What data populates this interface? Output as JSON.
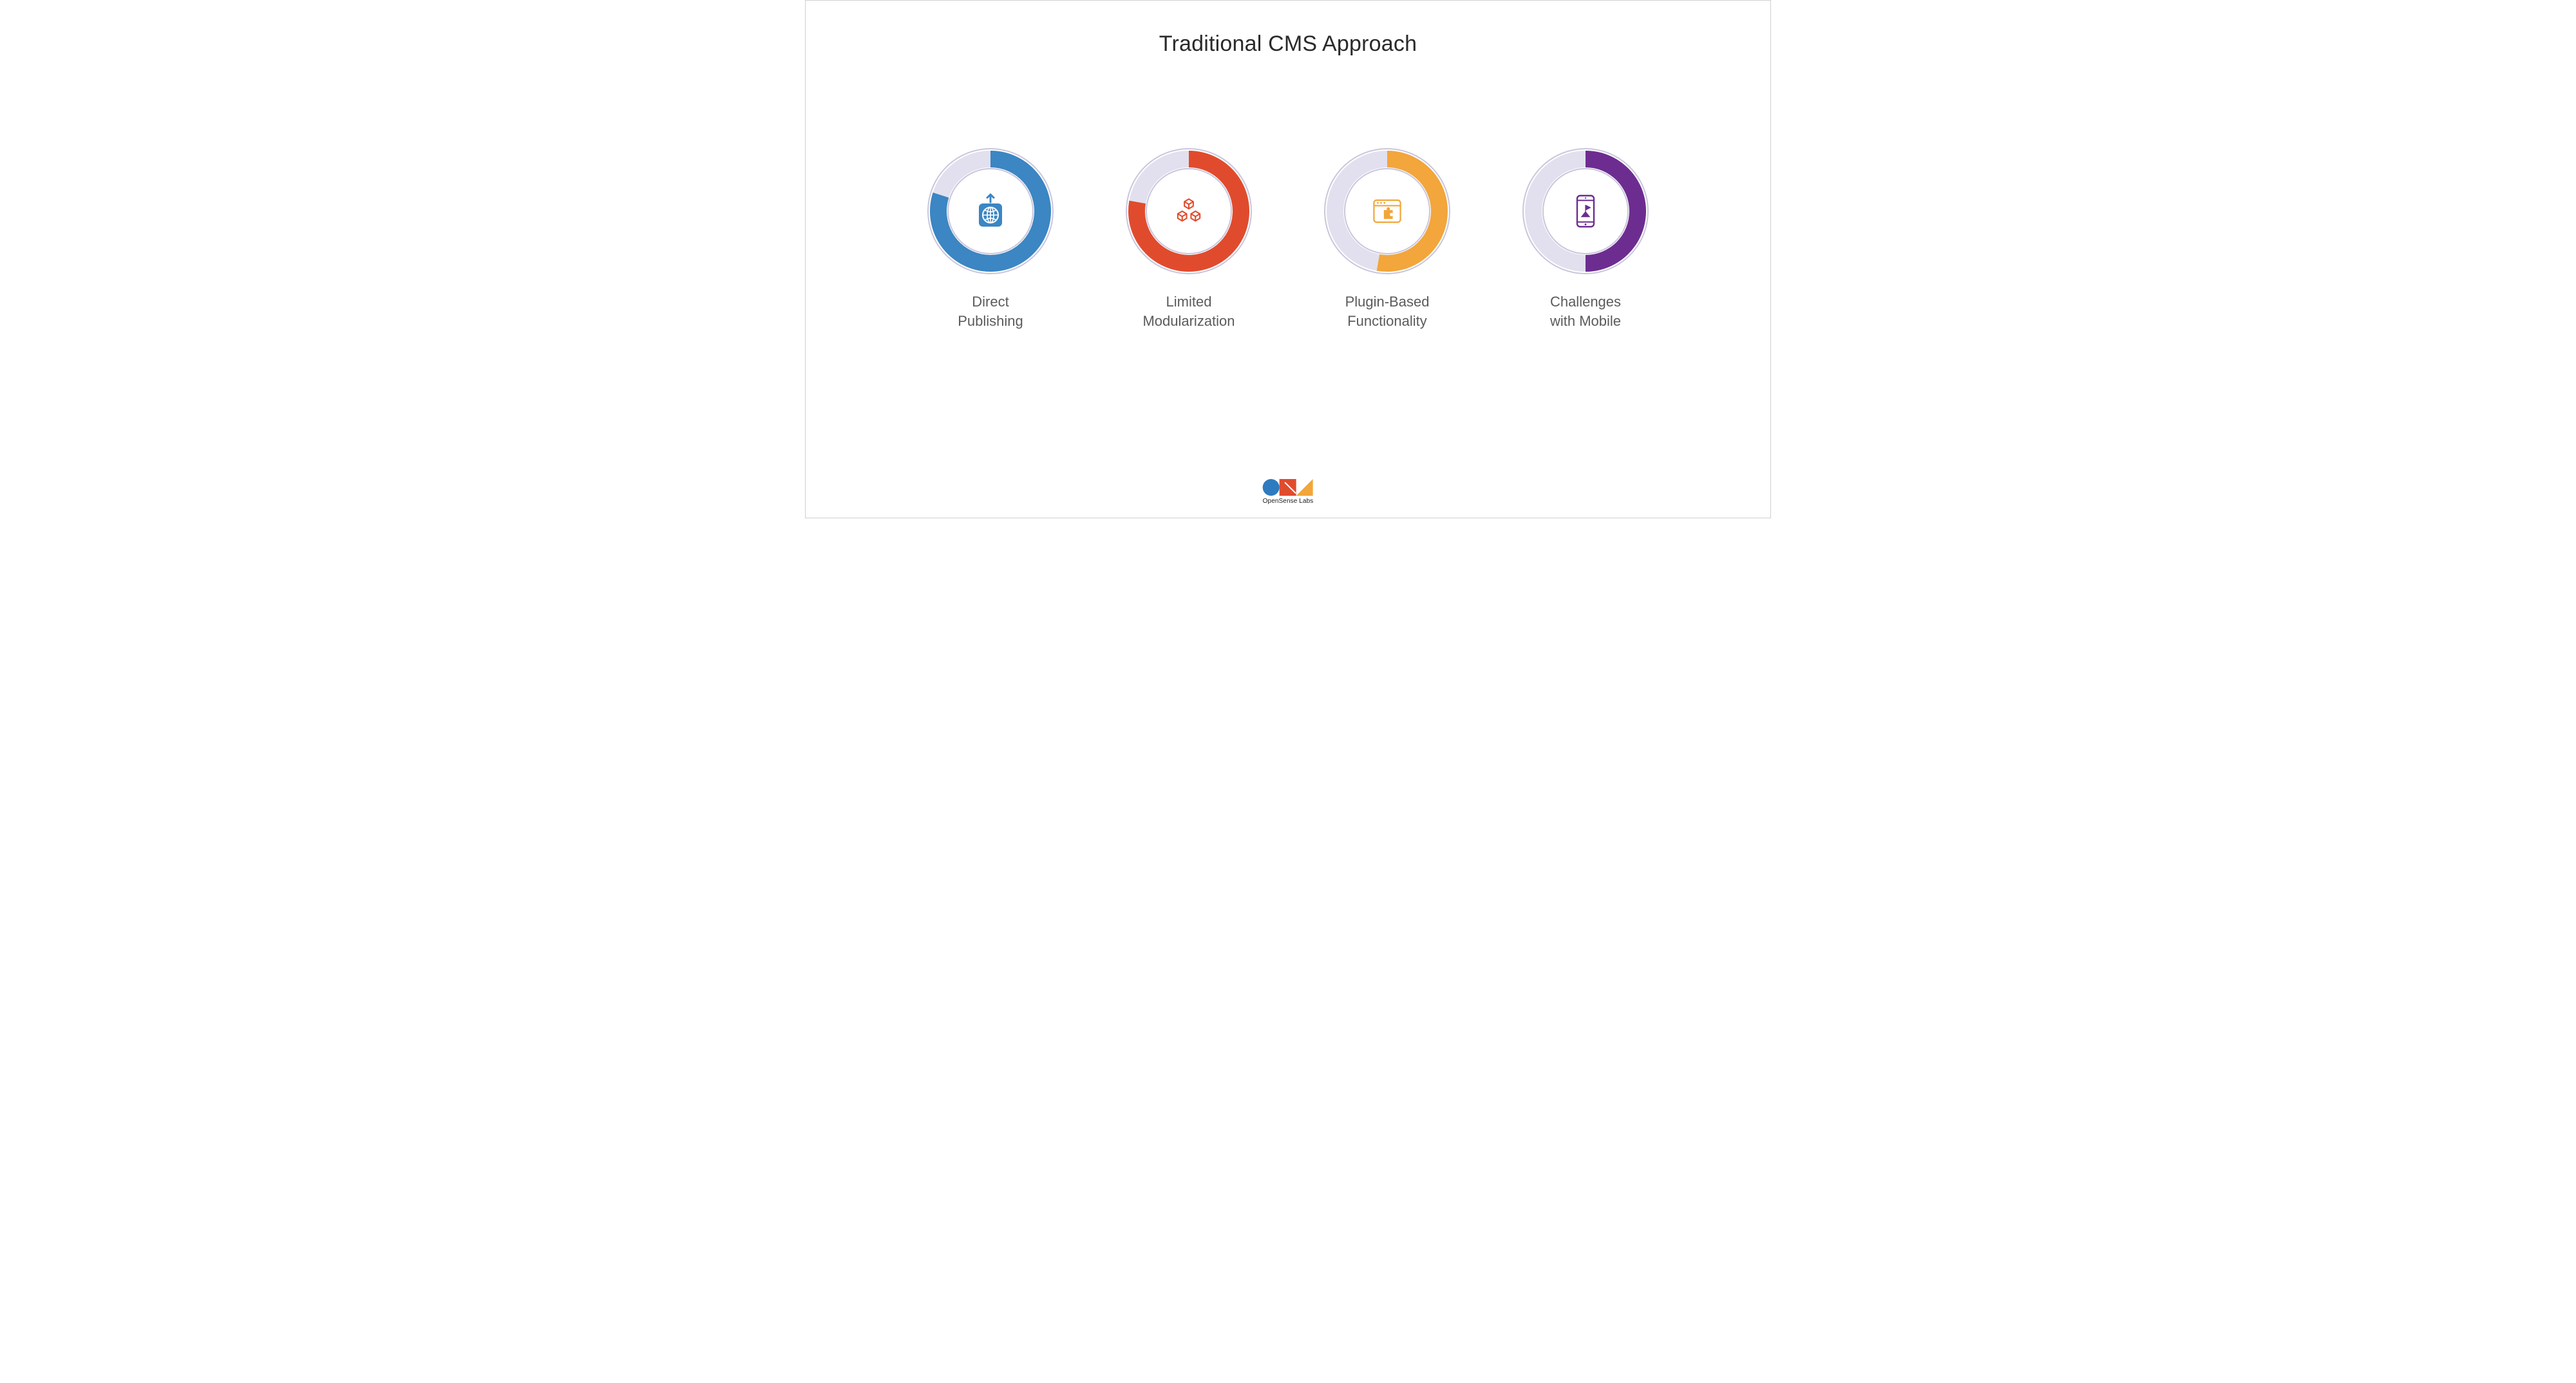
{
  "title": "Traditional CMS Approach",
  "items": [
    {
      "label": "Direct\nPublishing",
      "color": "#3b86c3",
      "arc_start_deg": 0,
      "arc_end_deg": 288,
      "icon": "globe-upload"
    },
    {
      "label": "Limited\nModularization",
      "color": "#e14b2d",
      "arc_start_deg": 0,
      "arc_end_deg": 280,
      "icon": "cubes"
    },
    {
      "label": "Plugin-Based\nFunctionality",
      "color": "#f2a63b",
      "arc_start_deg": 0,
      "arc_end_deg": 190,
      "icon": "browser-puzzle"
    },
    {
      "label": "Challenges\nwith Mobile",
      "color": "#6d2d90",
      "arc_start_deg": 0,
      "arc_end_deg": 180,
      "icon": "phone-flag"
    }
  ],
  "ring": {
    "outer_radius": 94,
    "ring_thickness": 26,
    "outline_color": "#c9c6dc",
    "track_color": "#e2e0ee",
    "inner_bg": "#ffffff"
  },
  "footer_brand": "OpenSense Labs"
}
